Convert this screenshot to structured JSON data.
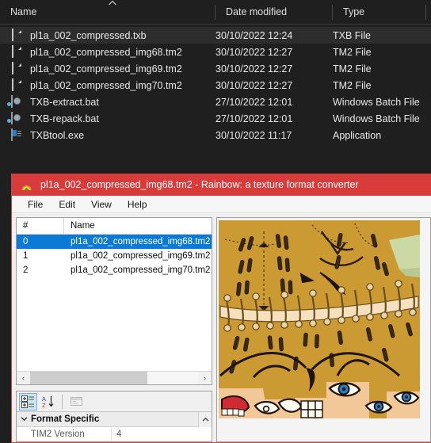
{
  "explorer": {
    "columns": [
      {
        "label": "Name",
        "key": "name"
      },
      {
        "label": "Date modified",
        "key": "date"
      },
      {
        "label": "Type",
        "key": "type"
      }
    ],
    "sort_indicator": "▲",
    "files": [
      {
        "name": "pl1a_002_compressed.txb",
        "date": "30/10/2022 12:24",
        "type": "TXB File",
        "icon": "document-icon",
        "selected": true
      },
      {
        "name": "pl1a_002_compressed_img68.tm2",
        "date": "30/10/2022 12:27",
        "type": "TM2 File",
        "icon": "document-icon",
        "selected": false
      },
      {
        "name": "pl1a_002_compressed_img69.tm2",
        "date": "30/10/2022 12:27",
        "type": "TM2 File",
        "icon": "document-icon",
        "selected": false
      },
      {
        "name": "pl1a_002_compressed_img70.tm2",
        "date": "30/10/2022 12:27",
        "type": "TM2 File",
        "icon": "document-icon",
        "selected": false
      },
      {
        "name": "TXB-extract.bat",
        "date": "27/10/2022 12:01",
        "type": "Windows Batch File",
        "icon": "batch-file-icon",
        "selected": false
      },
      {
        "name": "TXB-repack.bat",
        "date": "27/10/2022 12:01",
        "type": "Windows Batch File",
        "icon": "batch-file-icon",
        "selected": false
      },
      {
        "name": "TXBtool.exe",
        "date": "30/10/2022 11:17",
        "type": "Application",
        "icon": "application-icon",
        "selected": false
      }
    ]
  },
  "rainbow": {
    "title": "pl1a_002_compressed_img68.tm2 - Rainbow: a texture format converter",
    "title_icon": "rainbow-icon",
    "titlebar_color": "#d93b3b",
    "menu": [
      {
        "label": "File"
      },
      {
        "label": "Edit"
      },
      {
        "label": "View"
      },
      {
        "label": "Help"
      }
    ],
    "list": {
      "columns": [
        {
          "label": "#"
        },
        {
          "label": "Name"
        }
      ],
      "rows": [
        {
          "num": "0",
          "name": "pl1a_002_compressed_img68.tm2",
          "selected": true
        },
        {
          "num": "1",
          "name": "pl1a_002_compressed_img69.tm2",
          "selected": false
        },
        {
          "num": "2",
          "name": "pl1a_002_compressed_img70.tm2",
          "selected": false
        }
      ],
      "scroll_left_label": "‹",
      "scroll_right_label": "›"
    },
    "property_grid": {
      "toolbar": [
        {
          "name": "categorized-view-button",
          "state": "active"
        },
        {
          "name": "alphabetical-sort-button",
          "state": "normal"
        },
        {
          "name": "property-pages-button",
          "state": "disabled"
        }
      ],
      "group": {
        "label": "Format Specific",
        "expand_chevron": "⌄",
        "scroll_up": "˄"
      },
      "rows": [
        {
          "key": "TIM2 Version",
          "value": "4"
        }
      ]
    },
    "preview": {
      "name": "texture-preview",
      "background_color": "#cb9a33",
      "skin_color": "#f3c898",
      "ink_color": "#1a1208",
      "accent_green": "#ccd9a4",
      "accent_red": "#d02b33",
      "eye_blue": "#2e7fc4"
    }
  }
}
